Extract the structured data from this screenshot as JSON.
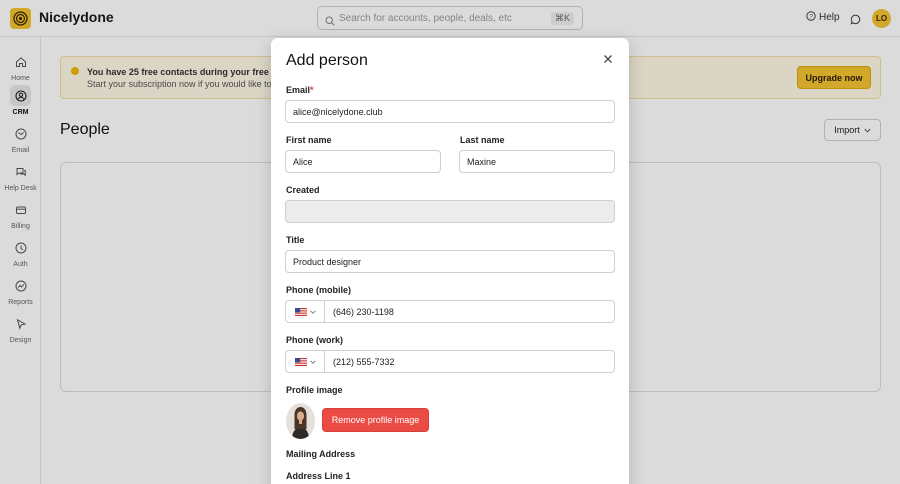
{
  "app": {
    "brand": "Nicelydone",
    "avatar_initials": "LO"
  },
  "search": {
    "placeholder": "Search for accounts, people, deals, etc",
    "shortcut": "⌘K"
  },
  "header": {
    "help_label": "Help"
  },
  "sidebar": {
    "items": [
      {
        "label": "Home",
        "icon": "home-icon",
        "active": false
      },
      {
        "label": "CRM",
        "icon": "crm-icon",
        "active": true
      },
      {
        "label": "Email",
        "icon": "email-icon",
        "active": false
      },
      {
        "label": "Help Desk",
        "icon": "help-desk-icon",
        "active": false
      },
      {
        "label": "Billing",
        "icon": "billing-icon",
        "active": false
      },
      {
        "label": "Auth",
        "icon": "auth-icon",
        "active": false
      },
      {
        "label": "Reports",
        "icon": "reports-icon",
        "active": false
      },
      {
        "label": "Design",
        "icon": "design-icon",
        "active": false
      }
    ]
  },
  "banner": {
    "line1": "You have 25 free contacts during your free trial",
    "line2": "Start your subscription now if you would like to",
    "upgrade_label": "Upgrade now"
  },
  "page": {
    "title": "People",
    "import_label": "Import"
  },
  "modal": {
    "title": "Add person",
    "email": {
      "label": "Email",
      "value": "alice@nicelydone.club"
    },
    "first_name": {
      "label": "First name",
      "value": "Alice"
    },
    "last_name": {
      "label": "Last name",
      "value": "Maxine"
    },
    "created": {
      "label": "Created",
      "value": ""
    },
    "title_field": {
      "label": "Title",
      "value": "Product designer"
    },
    "phone_mobile": {
      "label": "Phone (mobile)",
      "country": "US",
      "value": "(646) 230-1198"
    },
    "phone_work": {
      "label": "Phone (work)",
      "country": "US",
      "value": "(212) 555-7332"
    },
    "profile_image": {
      "label": "Profile image",
      "remove_label": "Remove profile image"
    },
    "mailing_address": {
      "label": "Mailing Address"
    },
    "address_line_1": {
      "label": "Address Line 1"
    }
  },
  "colors": {
    "accent": "#f4c430",
    "danger": "#ea4b45",
    "required": "#e03a3a"
  }
}
